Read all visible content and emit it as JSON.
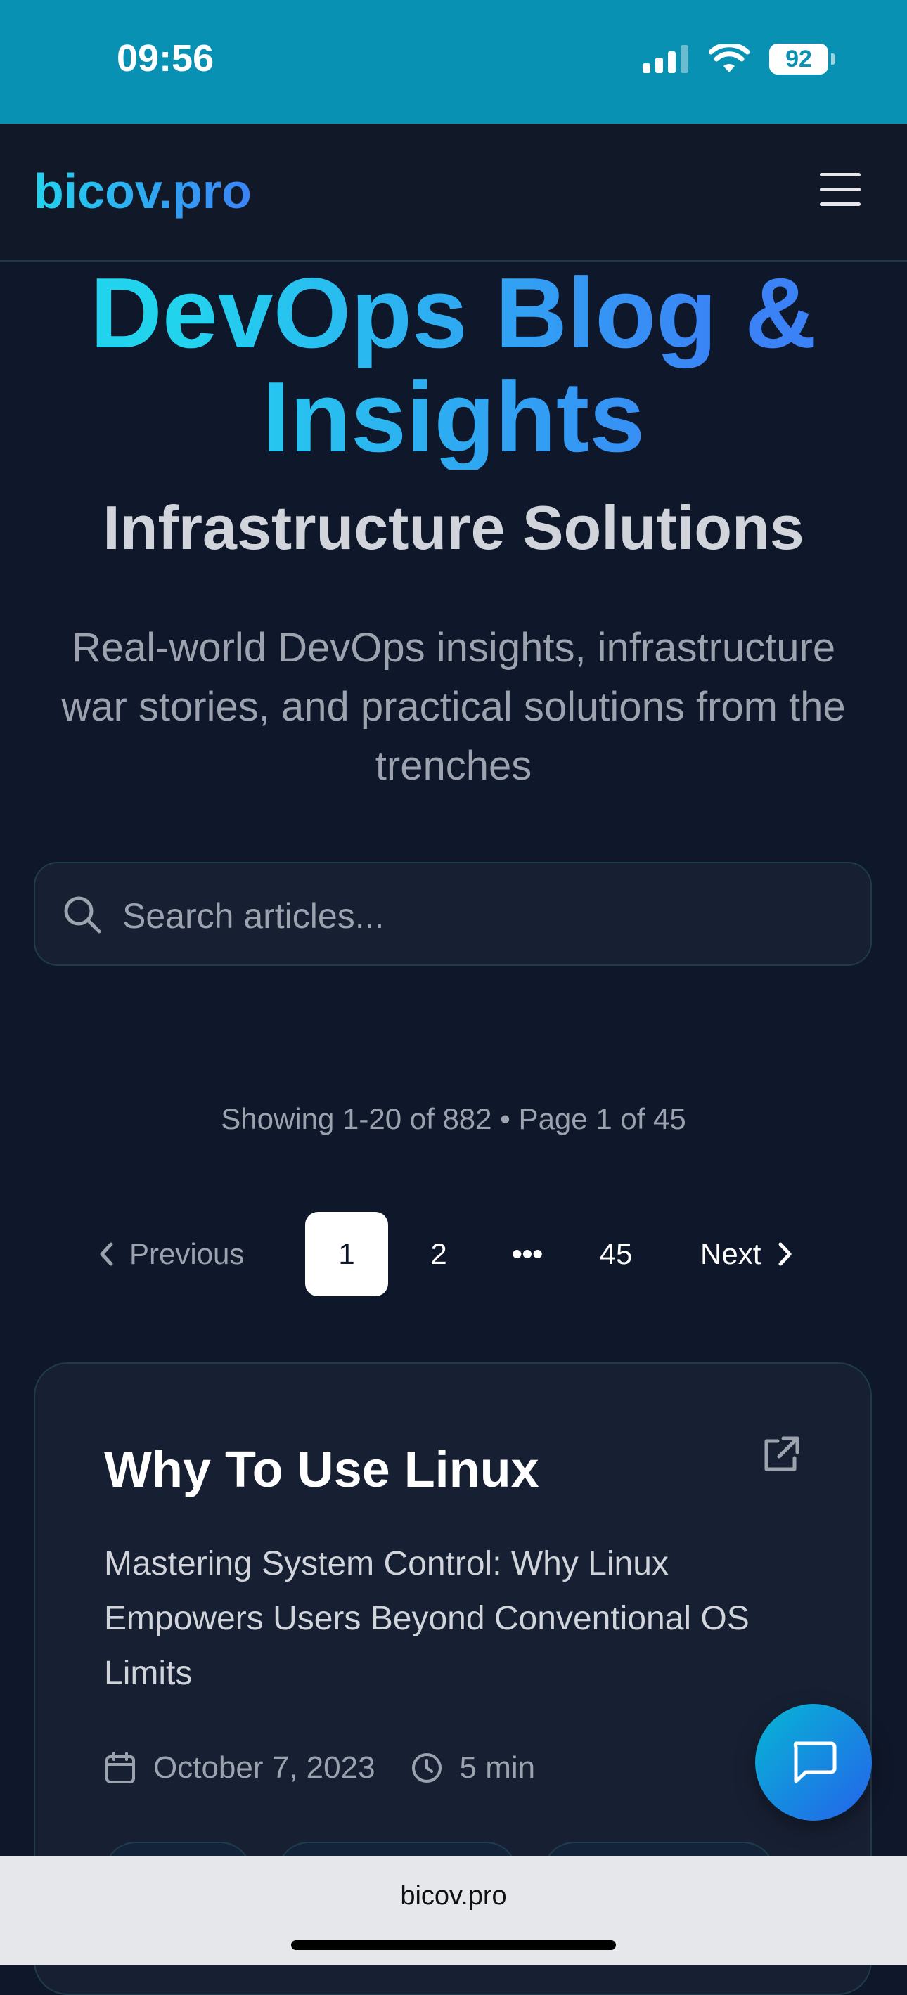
{
  "status_bar": {
    "time": "09:56",
    "battery": "92"
  },
  "header": {
    "brand": "bicov.pro"
  },
  "hero": {
    "title_line1": "DevOps Blog &",
    "title_line2": "Insights",
    "subtitle": "Infrastructure Solutions",
    "description": "Real-world DevOps insights, infrastructure war stories, and practical solutions from the trenches"
  },
  "search": {
    "placeholder": "Search articles..."
  },
  "results": {
    "summary": "Showing 1-20 of 882 • Page 1 of 45"
  },
  "pagination": {
    "previous": "Previous",
    "pages": [
      "1",
      "2",
      "•••",
      "45"
    ],
    "current": "1",
    "next": "Next"
  },
  "articles": [
    {
      "title": "Why To Use Linux",
      "description": "Mastering System Control: Why Linux Empowers Users Beyond Conventional OS Limits",
      "date": "October 7, 2023",
      "read_time": "5 min"
    }
  ],
  "browser": {
    "url": "bicov.pro"
  },
  "colors": {
    "accent_cyan": "#22d3ee",
    "accent_blue": "#3b82f6",
    "background": "#0f172a",
    "status_bar": "#0891b2"
  }
}
